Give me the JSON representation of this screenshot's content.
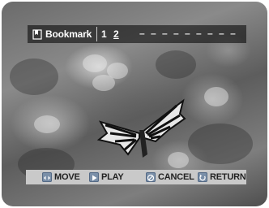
{
  "bookmark": {
    "label": "Bookmark",
    "slot1": "1",
    "slot2": "2",
    "empty_slots": "– – – – – – – – –",
    "icon": "bookmark-icon"
  },
  "controls": {
    "move_label": "MOVE",
    "play_label": "PLAY",
    "cancel_label": "CANCEL",
    "return_label": "RETURN",
    "move_icon": "arrows-icon",
    "play_icon": "play-icon",
    "cancel_icon": "cancel-icon",
    "return_icon": "return-icon"
  }
}
